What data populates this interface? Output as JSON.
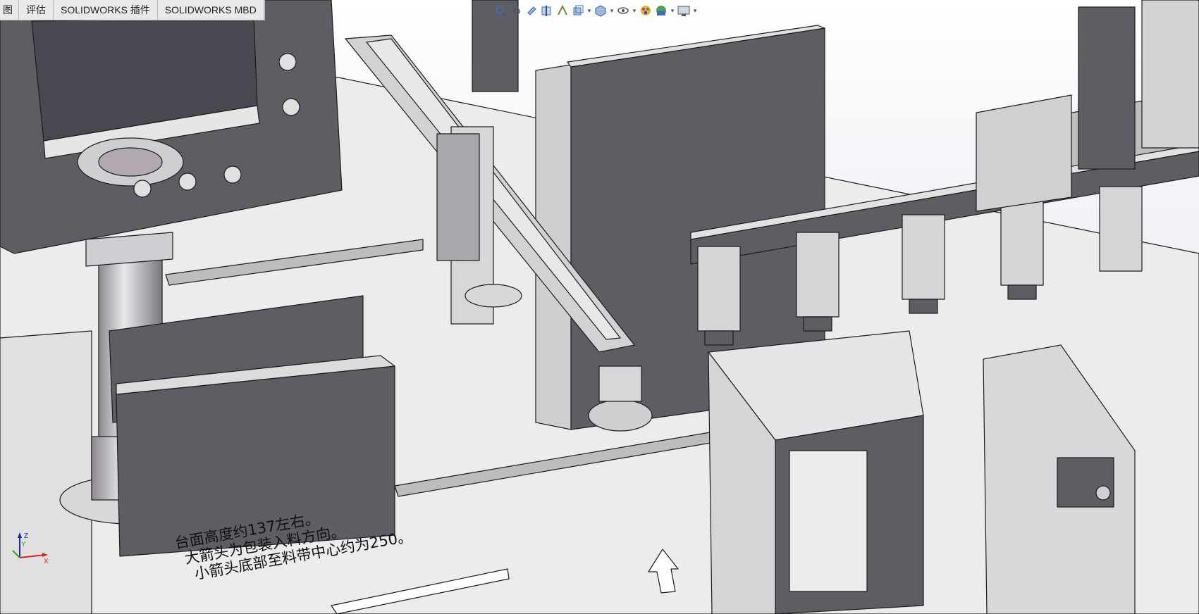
{
  "tabs": [
    {
      "label": "图"
    },
    {
      "label": "评估"
    },
    {
      "label": "SOLIDWORKS 插件"
    },
    {
      "label": "SOLIDWORKS MBD"
    }
  ],
  "heads_up_toolbar": [
    {
      "icon": "zoom-to-fit-icon"
    },
    {
      "icon": "zoom-to-area-icon"
    },
    {
      "icon": "previous-view-icon"
    },
    {
      "icon": "section-view-icon"
    },
    {
      "icon": "dynamic-annotation-icon"
    },
    {
      "icon": "view-orientation-icon"
    },
    {
      "icon": "display-style-icon"
    },
    {
      "icon": "hide-show-items-icon"
    },
    {
      "icon": "edit-appearance-icon"
    },
    {
      "icon": "apply-scene-icon"
    },
    {
      "icon": "view-settings-icon"
    }
  ],
  "triad": {
    "x_label": "X",
    "y_label": "Y",
    "z_label": "Z"
  },
  "annotation": {
    "line1": "台面高度约137左右。",
    "line2": "大箭头为包装入料方向。",
    "line3": "小箭头底部至料带中心约为250。"
  },
  "colors": {
    "part_fill": "#5f5c63",
    "part_light": "#d7d7d9",
    "table_top": "#ebebeb",
    "edge": "#1c1c1c",
    "background": "#ffffff"
  }
}
